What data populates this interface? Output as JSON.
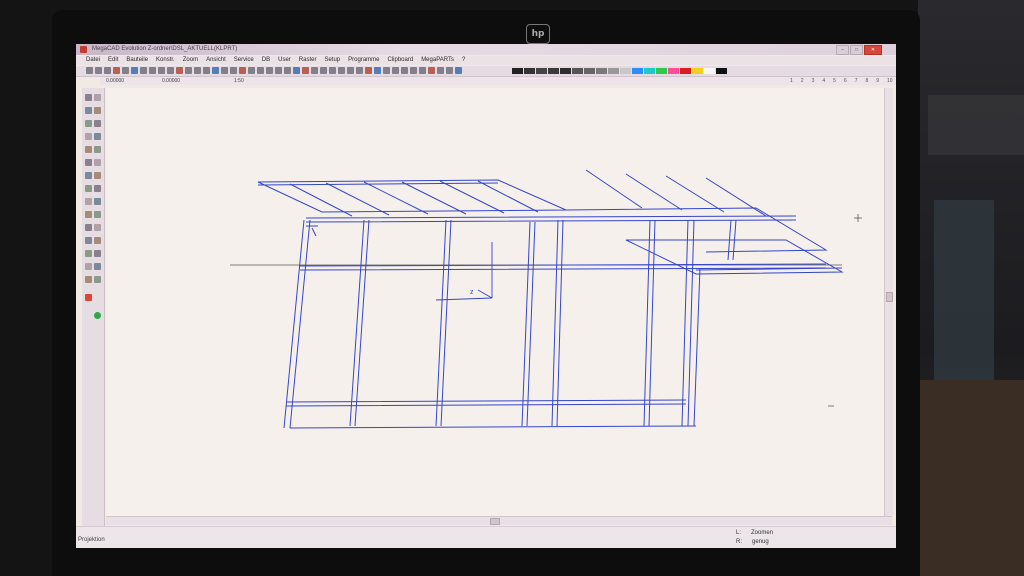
{
  "window": {
    "title": "MegaCAD Evolution  Z-ordner\\DSL_AKTUELL(KLPRT)",
    "controls": [
      "–",
      "□",
      "✕"
    ]
  },
  "menu": [
    "Datei",
    "Edit",
    "Bauteile",
    "Konstr.",
    "Zoom",
    "Ansicht",
    "Service",
    "DB",
    "User",
    "Raster",
    "Setup",
    "Programme",
    "Clipboard",
    "MegaPARTs",
    "?"
  ],
  "status_top": {
    "x": "0.00000",
    "y": "0.00000",
    "scale": "1:50"
  },
  "ruler": [
    "1",
    "2",
    "3",
    "4",
    "5",
    "6",
    "7",
    "8",
    "9",
    "10"
  ],
  "palette": [
    "#222222",
    "#333333",
    "#444444",
    "#3a3a3a",
    "#2e2e2e",
    "#555555",
    "#666666",
    "#7a7a7a",
    "#999999",
    "#c8c8c8",
    "#2b8cff",
    "#20c9c9",
    "#2ec94a",
    "#ff4d9a",
    "#d91e1e",
    "#f0d21e",
    "#f6f6f6",
    "#111111"
  ],
  "axis": {
    "z": "z"
  },
  "footer": {
    "project": "Projektion",
    "mouse_left_key": "L:",
    "mouse_left_action": "Zoomen",
    "mouse_right_key": "R:",
    "mouse_right_action": "genug"
  },
  "colors": {
    "line": "#3546c8",
    "screen": "#f1e9e4",
    "bezel": "#0d0d0d"
  },
  "icons": [
    "hp-logo",
    "app-icon",
    "green-arrow-icon",
    "red-g-icon"
  ]
}
